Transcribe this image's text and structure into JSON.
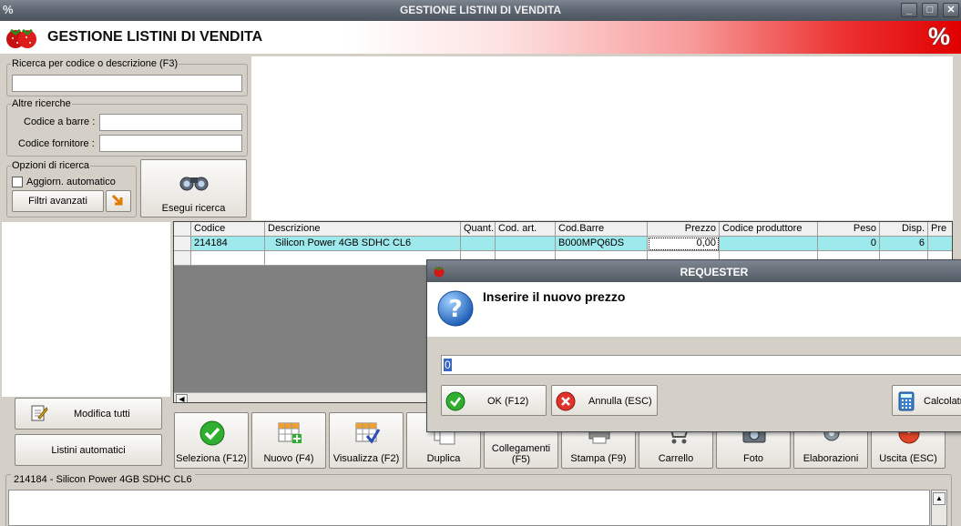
{
  "window": {
    "title": "GESTIONE LISTINI DI VENDITA",
    "app_icon": "%"
  },
  "header": {
    "title": "GESTIONE LISTINI DI VENDITA",
    "logo_icon": "strawberry-icon",
    "pct_icon": "%"
  },
  "search": {
    "group_label": "Ricerca per codice o descrizione (F3)",
    "value": "",
    "other_label": "Altre ricerche",
    "barcode_label": "Codice a barre :",
    "supplier_label": "Codice fornitore :",
    "options_label": "Opzioni di ricerca",
    "auto_update_label": "Aggiorn. automatico",
    "advanced_filters_label": "Filtri avanzati",
    "execute_label": "Esegui ricerca"
  },
  "table": {
    "columns": [
      "Codice",
      "Descrizione",
      "Quant.",
      "Cod. art.",
      "Cod.Barre",
      "Prezzo",
      "Codice produttore",
      "Peso",
      "Disp.",
      "Pre"
    ],
    "rows": [
      {
        "codice": "214184",
        "descrizione": "Silicon Power 4GB SDHC CL6",
        "quant": "",
        "cod_art": "",
        "cod_barre": "B000MPQ6DS",
        "prezzo": "0,00",
        "cod_prod": "",
        "peso": "0",
        "disp": "6",
        "pre": ""
      }
    ]
  },
  "left_buttons": {
    "edit_all": "Modifica tutti",
    "auto_lists": "Listini automatici"
  },
  "toolbar": {
    "select": "Seleziona (F12)",
    "new": "Nuovo (F4)",
    "view": "Visualizza (F2)",
    "duplicate": "Duplica",
    "links": "Collegamenti (F5)",
    "print": "Stampa (F9)",
    "cart": "Carrello",
    "photo": "Foto",
    "process": "Elaborazioni",
    "exit": "Uscita (ESC)"
  },
  "bottom": {
    "label": "214184 -    Silicon Power 4GB SDHC CL6"
  },
  "dialog": {
    "title": "REQUESTER",
    "message": "Inserire il nuovo prezzo",
    "input_value": "0",
    "ok_label": "OK (F12)",
    "cancel_label": "Annulla (ESC)",
    "calc_label": "Calcolatrice"
  }
}
